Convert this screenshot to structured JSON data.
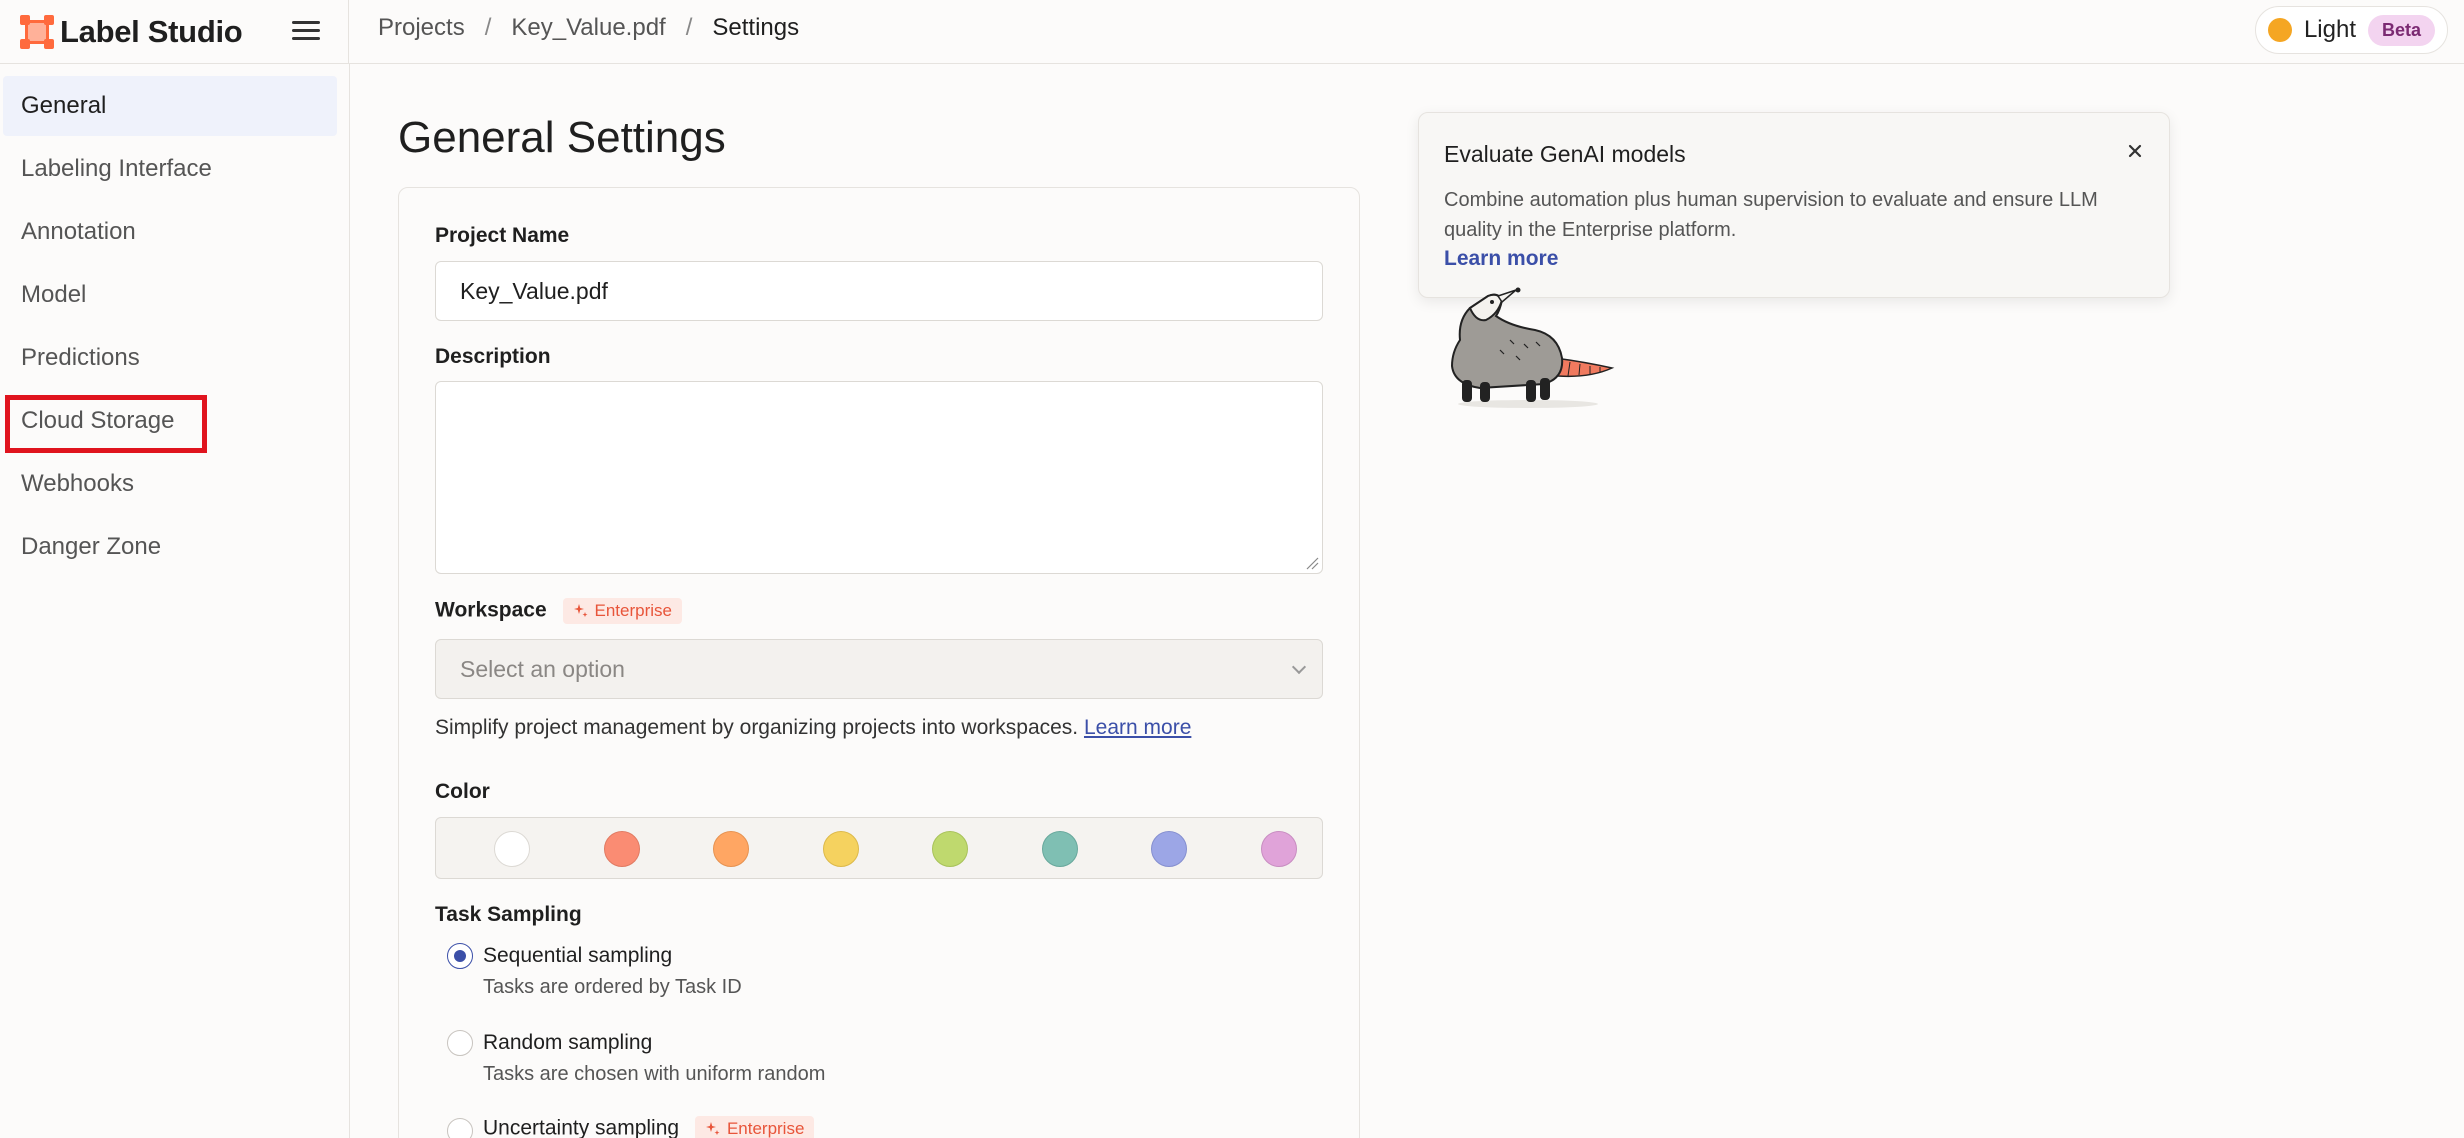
{
  "app": {
    "name": "Label Studio"
  },
  "breadcrumb": {
    "items": [
      "Projects",
      "Key_Value.pdf",
      "Settings"
    ]
  },
  "theme": {
    "label": "Light",
    "badge": "Beta"
  },
  "sidebar": {
    "items": [
      {
        "label": "General",
        "active": true
      },
      {
        "label": "Labeling Interface"
      },
      {
        "label": "Annotation"
      },
      {
        "label": "Model"
      },
      {
        "label": "Predictions"
      },
      {
        "label": "Cloud Storage"
      },
      {
        "label": "Webhooks"
      },
      {
        "label": "Danger Zone"
      }
    ]
  },
  "main": {
    "title": "General Settings",
    "project_name": {
      "label": "Project Name",
      "value": "Key_Value.pdf"
    },
    "description": {
      "label": "Description",
      "value": ""
    },
    "workspace": {
      "label": "Workspace",
      "badge": "Enterprise",
      "placeholder": "Select an option",
      "help": "Simplify project management by organizing projects into workspaces.",
      "help_link": "Learn more"
    },
    "color": {
      "label": "Color",
      "swatches": [
        "#ffffff",
        "#fa8c73",
        "#ffa663",
        "#f5d25f",
        "#bfd96e",
        "#7fbfb3",
        "#9ca6e6",
        "#e0a3d9"
      ]
    },
    "sampling": {
      "label": "Task Sampling",
      "options": [
        {
          "title": "Sequential sampling",
          "desc": "Tasks are ordered by Task ID",
          "selected": true
        },
        {
          "title": "Random sampling",
          "desc": "Tasks are chosen with uniform random",
          "selected": false
        },
        {
          "title": "Uncertainty sampling",
          "badge": "Enterprise",
          "selected": false
        }
      ]
    }
  },
  "promo": {
    "title": "Evaluate GenAI models",
    "body": "Combine automation plus human supervision to evaluate and ensure LLM quality in the Enterprise platform.",
    "link": "Learn more"
  },
  "colors": {
    "accent": "#3b4fa8",
    "brand": "#ff6a3d",
    "highlight": "#e0141e"
  }
}
